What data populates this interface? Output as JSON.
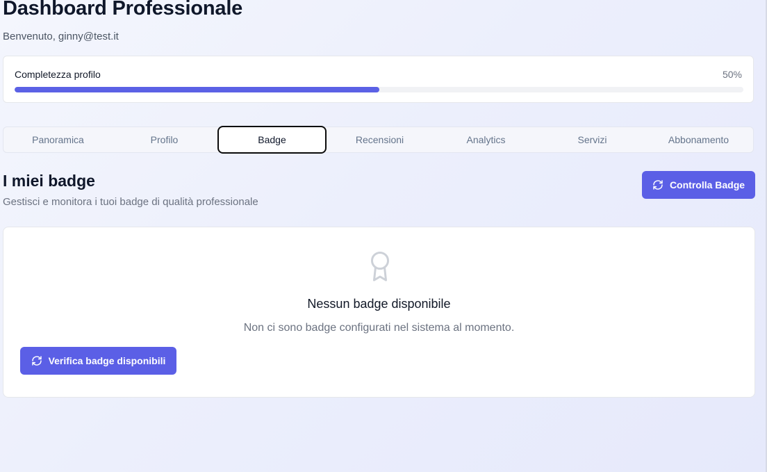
{
  "header": {
    "title": "Dashboard Professionale",
    "welcome_prefix": "Benvenuto,",
    "user_email": "ginny@test.it"
  },
  "profile_completion": {
    "label": "Completezza profilo",
    "percent_label": "50%",
    "percent_value": 50,
    "bar_color": "#5b61e5"
  },
  "tabs": [
    {
      "label": "Panoramica",
      "active": false
    },
    {
      "label": "Profilo",
      "active": false
    },
    {
      "label": "Badge",
      "active": true
    },
    {
      "label": "Recensioni",
      "active": false
    },
    {
      "label": "Analytics",
      "active": false
    },
    {
      "label": "Servizi",
      "active": false
    },
    {
      "label": "Abbonamento",
      "active": false
    }
  ],
  "badges_section": {
    "title": "I miei badge",
    "subtitle": "Gestisci e monitora i tuoi badge di qualità professionale",
    "check_button_label": "Controlla Badge",
    "check_button_icon": "refresh-icon"
  },
  "empty_state": {
    "icon": "award-icon",
    "title": "Nessun badge disponibile",
    "text": "Non ci sono badge configurati nel sistema al momento.",
    "verify_button_label": "Verifica badge disponibili",
    "verify_button_icon": "refresh-icon"
  },
  "colors": {
    "accent": "#5b5fe6",
    "active_tab_border": "#0b0b0b"
  }
}
